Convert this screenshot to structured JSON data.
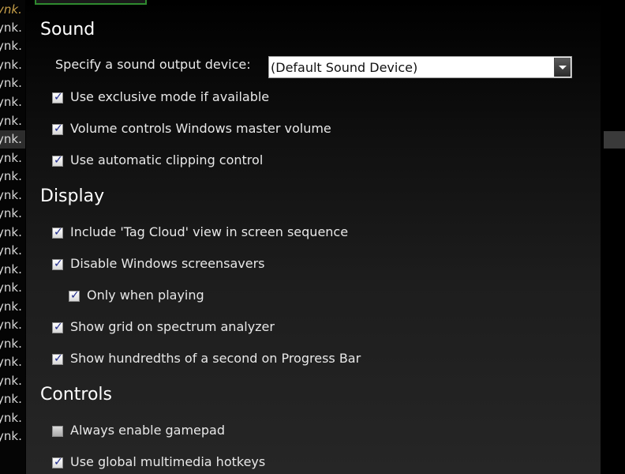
{
  "list": {
    "items": [
      "ynk.",
      "ynk.",
      "ynk.",
      "ynk.",
      "ynk.",
      "ynk.",
      "ynk.",
      "ynk.",
      "ynk.",
      "ynk.",
      "ynk.",
      "ynk.",
      "ynk.",
      "ynk.",
      "ynk.",
      "ynk.",
      "ynk.",
      "ynk.",
      "ynk.",
      "ynk.",
      "ynk.",
      "ynk.",
      "ynk.",
      "ynk."
    ]
  },
  "sections": {
    "sound": {
      "title": "Sound",
      "device_label": "Specify a sound output device:",
      "device_value": "(Default Sound Device)",
      "options": [
        {
          "label": "Use exclusive mode if available",
          "checked": true
        },
        {
          "label": "Volume controls Windows master volume",
          "checked": true
        },
        {
          "label": "Use automatic clipping control",
          "checked": true
        }
      ]
    },
    "display": {
      "title": "Display",
      "options": [
        {
          "label": "Include 'Tag Cloud' view in screen sequence",
          "checked": true
        },
        {
          "label": "Disable Windows screensavers",
          "checked": true
        },
        {
          "label": "Only when playing",
          "checked": true
        },
        {
          "label": "Show grid on spectrum analyzer",
          "checked": true
        },
        {
          "label": "Show hundredths of a second on Progress Bar",
          "checked": true
        }
      ]
    },
    "controls": {
      "title": "Controls",
      "options": [
        {
          "label": "Always enable gamepad",
          "checked": false
        },
        {
          "label": "Use global multimedia hotkeys",
          "checked": true
        }
      ]
    }
  },
  "colors": {
    "accent_green": "#2f8a2f",
    "check_mark": "#1f2a8c"
  }
}
